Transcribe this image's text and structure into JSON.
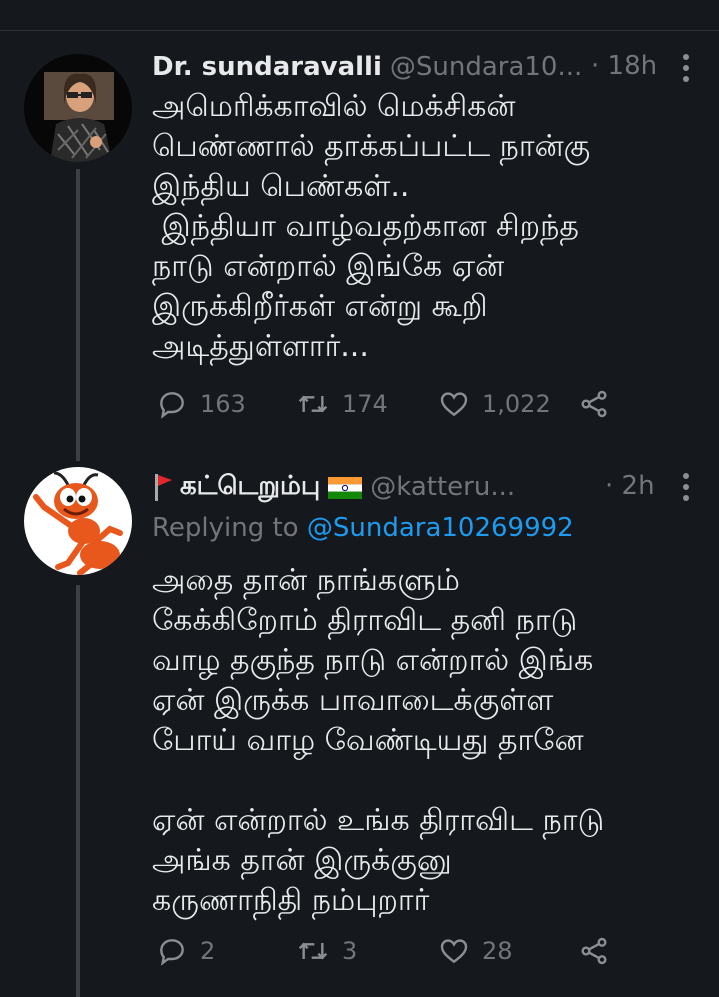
{
  "tweets": [
    {
      "display_name": "Dr. sundaravalli",
      "handle": "@Sundara10...",
      "time": "· 18h",
      "text": "அமெரிக்காவில் மெக்சிகன்\nபெண்ணால் தாக்கப்பட்ட நான்கு\nஇந்திய பெண்கள்..\n இந்தியா வாழ்வதற்கான சிறந்த\nநாடு என்றால் இங்கே ஏன்\nஇருக்கிறீர்கள் என்று கூறி\nஅடித்துள்ளார்...",
      "replies": "163",
      "retweets": "174",
      "likes": "1,022"
    },
    {
      "display_name": "கட்டெறும்பு",
      "handle": "@katteru...",
      "time": "· 2h",
      "replying_label": "Replying to",
      "replying_to": "@Sundara10269992",
      "text": "அதை தான் நாங்களும்\nகேக்கிறோம் திராவிட தனி நாடு\nவாழ தகுந்த நாடு என்றால் இங்க\nஏன் இருக்க பாவாடைக்குள்ள\nபோய் வாழ வேண்டியது தானே\n\nஏன் என்றால் உங்க திராவிட நாடு\nஅங்க தான் இருக்குனு\nகருணாநிதி நம்புறார்",
      "replies": "2",
      "retweets": "3",
      "likes": "28"
    }
  ],
  "icons": {
    "reply": "reply-icon",
    "retweet": "retweet-icon",
    "like": "heart-icon",
    "share": "share-icon",
    "more": "more-icon"
  },
  "colors": {
    "background": "#15181c",
    "text": "#e7e9ea",
    "secondary": "#71767b",
    "link": "#1d9bf0",
    "thread_line": "#3e4144"
  }
}
